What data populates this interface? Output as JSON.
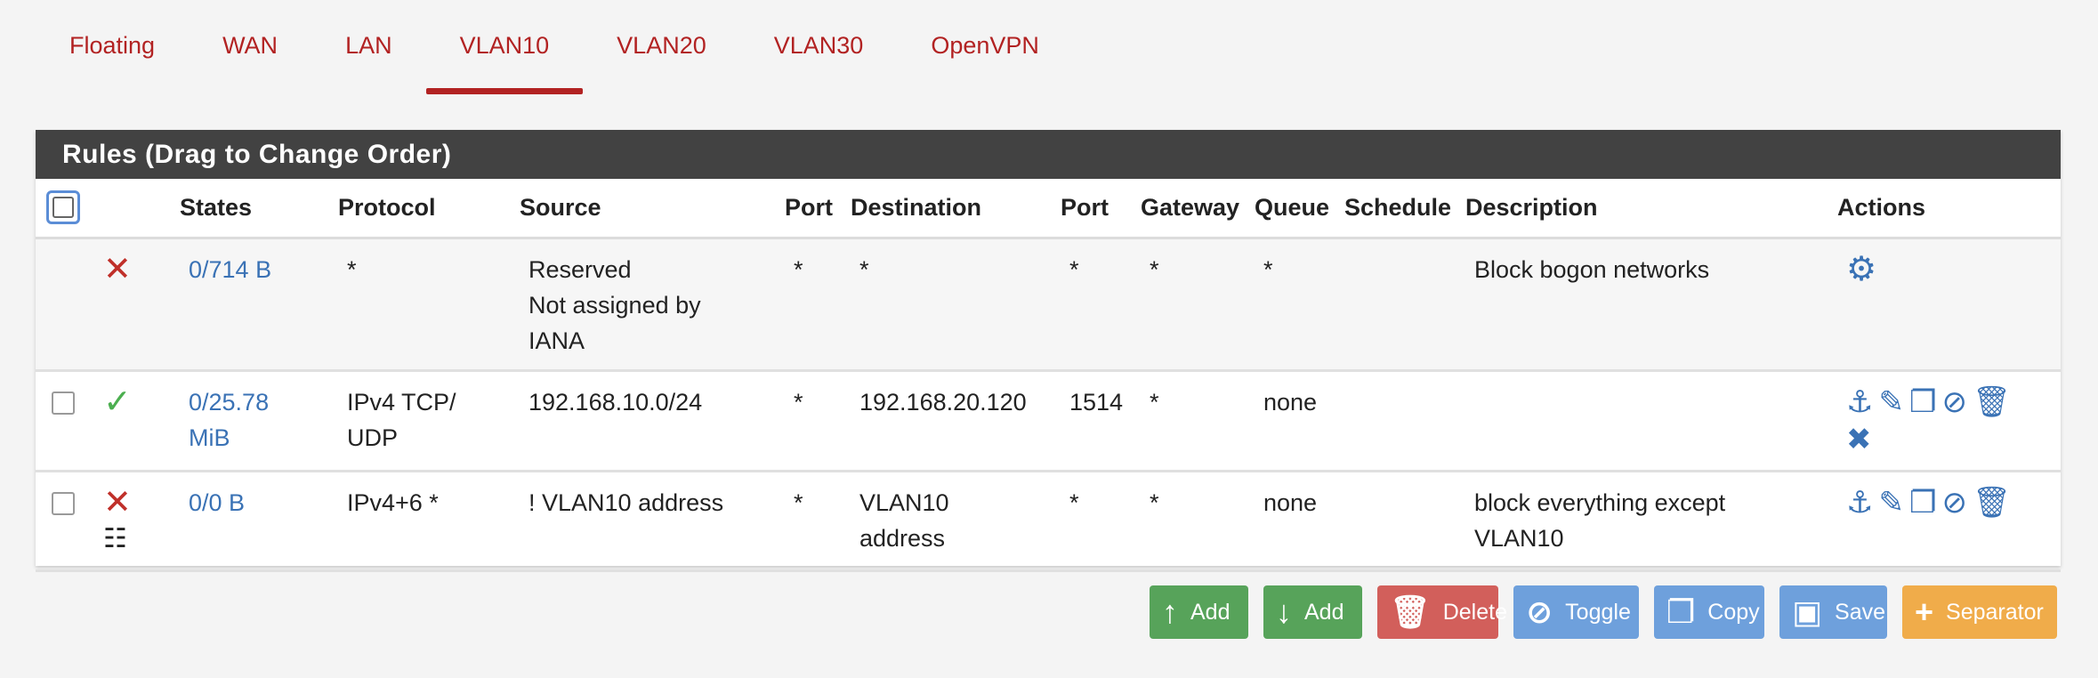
{
  "tabs": [
    {
      "label": "Floating"
    },
    {
      "label": "WAN"
    },
    {
      "label": "LAN"
    },
    {
      "label": "VLAN10",
      "active": true
    },
    {
      "label": "VLAN20"
    },
    {
      "label": "VLAN30"
    },
    {
      "label": "OpenVPN"
    }
  ],
  "panel": {
    "title": "Rules (Drag to Change Order)"
  },
  "columns": [
    "States",
    "Protocol",
    "Source",
    "Port",
    "Destination",
    "Port",
    "Gateway",
    "Queue",
    "Schedule",
    "Description",
    "Actions"
  ],
  "rows": [
    {
      "states_line1": "0/714 B",
      "states_line2": "",
      "protocol_line1": "*",
      "protocol_line2": "",
      "source_line1": "Reserved",
      "source_line2": "Not assigned by",
      "source_line3": "IANA",
      "source_port": "*",
      "destination_line1": "*",
      "destination_line2": "",
      "dest_port": "*",
      "gateway": "*",
      "queue": "*",
      "schedule": "",
      "description_line1": "Block bogon networks",
      "description_line2": ""
    },
    {
      "states_line1": "0/25.78",
      "states_line2": "MiB",
      "protocol_line1": "IPv4 TCP/",
      "protocol_line2": "UDP",
      "source_line1": "192.168.10.0/24",
      "source_line2": "",
      "source_line3": "",
      "source_port": "*",
      "destination_line1": "192.168.20.120",
      "destination_line2": "",
      "dest_port": "1514",
      "gateway": "*",
      "queue": "none",
      "schedule": "",
      "description_line1": "",
      "description_line2": ""
    },
    {
      "states_line1": "0/0 B",
      "states_line2": "",
      "protocol_line1": "IPv4+6 *",
      "protocol_line2": "",
      "source_line1": "! VLAN10 address",
      "source_line2": "",
      "source_line3": "",
      "source_port": "*",
      "destination_line1": "VLAN10",
      "destination_line2": "address",
      "dest_port": "*",
      "gateway": "*",
      "queue": "none",
      "schedule": "",
      "description_line1": "block everything except",
      "description_line2": "VLAN10"
    }
  ],
  "buttons": {
    "add_top": "Add",
    "add_bottom": "Add",
    "delete": "Delete",
    "toggle": "Toggle",
    "copy": "Copy",
    "save": "Save",
    "separator": "Separator"
  },
  "colors": {
    "accent": "#b22222",
    "link": "#3a72b5",
    "header_bg": "#424242",
    "green": "#57a35a",
    "red": "#d25f5b",
    "blue": "#6ea0dc",
    "orange": "#f0ac4a"
  },
  "icons": {
    "status_block": "x-icon",
    "status_pass": "check-icon",
    "schedule_list": "list-check-icon",
    "bogon_action": "gear-icon",
    "rule_actions": [
      "anchor-icon",
      "pencil-icon",
      "copy-icon",
      "ban-icon",
      "trash-icon",
      "x-icon"
    ]
  }
}
